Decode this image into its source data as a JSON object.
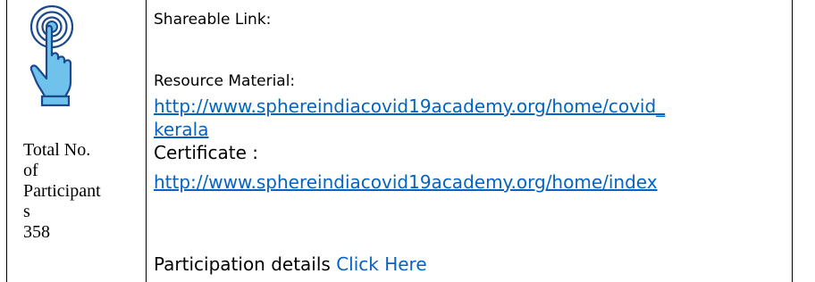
{
  "icon": {
    "name": "touch-tap-icon",
    "fill": "#6fc2ec",
    "stroke": "#1b4a8c"
  },
  "left_cell": {
    "lines": [
      "Total No.",
      "of",
      "Participant",
      "s",
      "358"
    ]
  },
  "right_cell": {
    "shareable_link_label": "Shareable Link:",
    "resource_material_label": "Resource Material:",
    "resource_link_line1": "http://www.sphereindiacovid19academy.org/home/covid_",
    "resource_link_line2": "kerala",
    "certificate_label": "Certificate  :",
    "certificate_link": "http://www.sphereindiacovid19academy.org/home/index",
    "participation_label": "Participation details ",
    "participation_link": "Click Here"
  },
  "colors": {
    "link": "#0563c1",
    "border": "#000000"
  }
}
